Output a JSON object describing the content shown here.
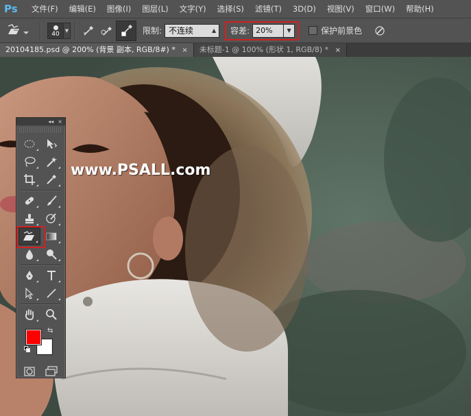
{
  "app": {
    "logo": "Ps",
    "menus": [
      "文件(F)",
      "编辑(E)",
      "图像(I)",
      "图层(L)",
      "文字(Y)",
      "选择(S)",
      "滤镜(T)",
      "3D(D)",
      "视图(V)",
      "窗口(W)",
      "帮助(H)"
    ]
  },
  "options": {
    "brush_size": "40",
    "limit_label": "限制:",
    "limit_value": "不连续",
    "tolerance_label": "容差:",
    "tolerance_value": "20%",
    "protect_fg_label": "保护前景色"
  },
  "tabs": [
    {
      "label": "20104185.psd @ 200% (背景 副本, RGB/8#) *",
      "close": "×"
    },
    {
      "label": "未标题-1 @ 100% (形状 1, RGB/8) *",
      "close": "×"
    }
  ],
  "canvas": {
    "watermark": "www.PSALL.com"
  },
  "tools_panel": {
    "header_collapse": "◂◂",
    "header_close": "×",
    "fg_color": "#ff0000",
    "bg_color": "#ffffff"
  }
}
